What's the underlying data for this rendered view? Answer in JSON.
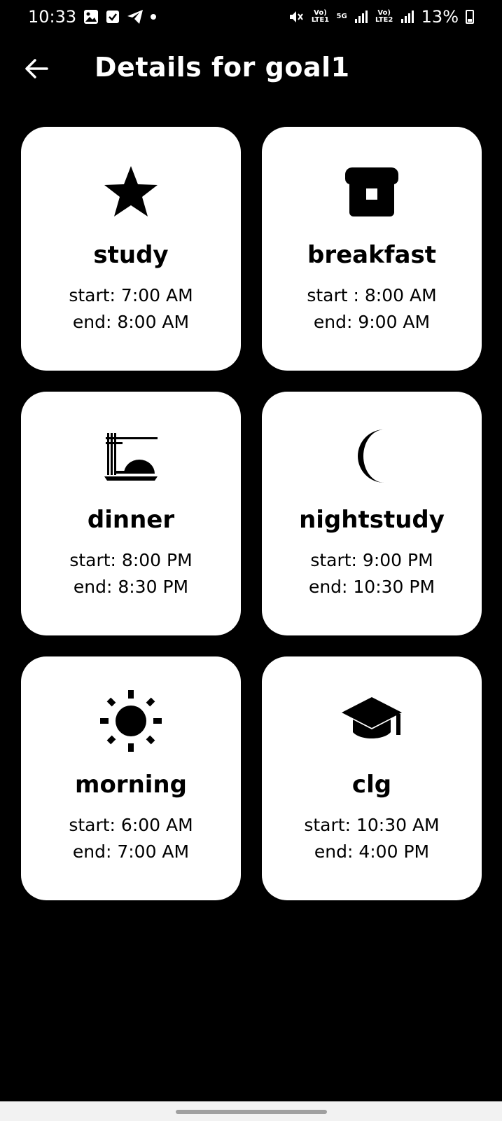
{
  "status_bar": {
    "time": "10:33",
    "battery": "13%",
    "sim1": "Vo) LTE1",
    "sim2": "Vo) LTE2",
    "network": "5G"
  },
  "header": {
    "title": "Details for goal1",
    "back_icon": "arrow-left-icon"
  },
  "goals": [
    {
      "icon": "star-icon",
      "title": "study",
      "start": "start: 7:00 AM",
      "end": "end: 8:00 AM"
    },
    {
      "icon": "breakfast-icon",
      "title": "breakfast",
      "start": "start : 8:00 AM",
      "end": "end: 9:00 AM"
    },
    {
      "icon": "dinner-icon",
      "title": "dinner",
      "start": "start: 8:00 PM",
      "end": "end: 8:30 PM"
    },
    {
      "icon": "moon-icon",
      "title": "nightstudy",
      "start": "start: 9:00 PM",
      "end": "end: 10:30 PM"
    },
    {
      "icon": "sun-icon",
      "title": "morning",
      "start": "start: 6:00 AM",
      "end": "end: 7:00 AM"
    },
    {
      "icon": "graduation-cap-icon",
      "title": "clg",
      "start": "start: 10:30 AM",
      "end": "end: 4:00 PM"
    }
  ],
  "colors": {
    "background": "#000000",
    "card": "#ffffff",
    "text_on_card": "#000000"
  }
}
